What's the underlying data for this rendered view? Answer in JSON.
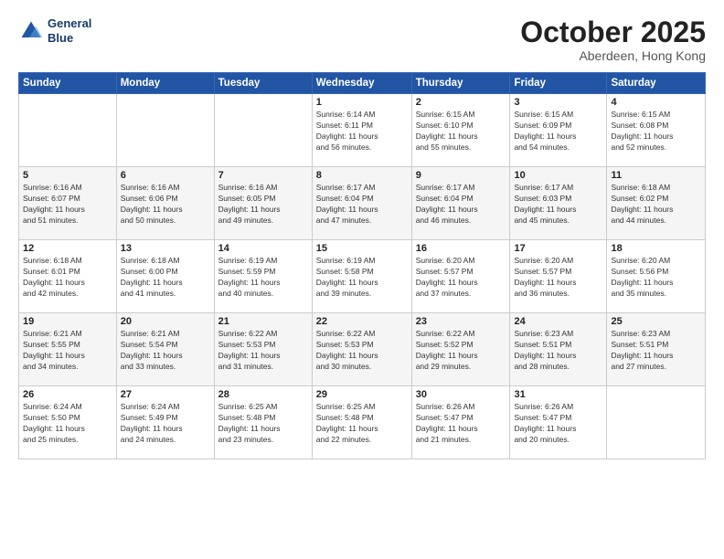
{
  "header": {
    "logo_line1": "General",
    "logo_line2": "Blue",
    "month": "October 2025",
    "location": "Aberdeen, Hong Kong"
  },
  "weekdays": [
    "Sunday",
    "Monday",
    "Tuesday",
    "Wednesday",
    "Thursday",
    "Friday",
    "Saturday"
  ],
  "weeks": [
    [
      {
        "day": "",
        "info": ""
      },
      {
        "day": "",
        "info": ""
      },
      {
        "day": "",
        "info": ""
      },
      {
        "day": "1",
        "info": "Sunrise: 6:14 AM\nSunset: 6:11 PM\nDaylight: 11 hours\nand 56 minutes."
      },
      {
        "day": "2",
        "info": "Sunrise: 6:15 AM\nSunset: 6:10 PM\nDaylight: 11 hours\nand 55 minutes."
      },
      {
        "day": "3",
        "info": "Sunrise: 6:15 AM\nSunset: 6:09 PM\nDaylight: 11 hours\nand 54 minutes."
      },
      {
        "day": "4",
        "info": "Sunrise: 6:15 AM\nSunset: 6:08 PM\nDaylight: 11 hours\nand 52 minutes."
      }
    ],
    [
      {
        "day": "5",
        "info": "Sunrise: 6:16 AM\nSunset: 6:07 PM\nDaylight: 11 hours\nand 51 minutes."
      },
      {
        "day": "6",
        "info": "Sunrise: 6:16 AM\nSunset: 6:06 PM\nDaylight: 11 hours\nand 50 minutes."
      },
      {
        "day": "7",
        "info": "Sunrise: 6:16 AM\nSunset: 6:05 PM\nDaylight: 11 hours\nand 49 minutes."
      },
      {
        "day": "8",
        "info": "Sunrise: 6:17 AM\nSunset: 6:04 PM\nDaylight: 11 hours\nand 47 minutes."
      },
      {
        "day": "9",
        "info": "Sunrise: 6:17 AM\nSunset: 6:04 PM\nDaylight: 11 hours\nand 46 minutes."
      },
      {
        "day": "10",
        "info": "Sunrise: 6:17 AM\nSunset: 6:03 PM\nDaylight: 11 hours\nand 45 minutes."
      },
      {
        "day": "11",
        "info": "Sunrise: 6:18 AM\nSunset: 6:02 PM\nDaylight: 11 hours\nand 44 minutes."
      }
    ],
    [
      {
        "day": "12",
        "info": "Sunrise: 6:18 AM\nSunset: 6:01 PM\nDaylight: 11 hours\nand 42 minutes."
      },
      {
        "day": "13",
        "info": "Sunrise: 6:18 AM\nSunset: 6:00 PM\nDaylight: 11 hours\nand 41 minutes."
      },
      {
        "day": "14",
        "info": "Sunrise: 6:19 AM\nSunset: 5:59 PM\nDaylight: 11 hours\nand 40 minutes."
      },
      {
        "day": "15",
        "info": "Sunrise: 6:19 AM\nSunset: 5:58 PM\nDaylight: 11 hours\nand 39 minutes."
      },
      {
        "day": "16",
        "info": "Sunrise: 6:20 AM\nSunset: 5:57 PM\nDaylight: 11 hours\nand 37 minutes."
      },
      {
        "day": "17",
        "info": "Sunrise: 6:20 AM\nSunset: 5:57 PM\nDaylight: 11 hours\nand 36 minutes."
      },
      {
        "day": "18",
        "info": "Sunrise: 6:20 AM\nSunset: 5:56 PM\nDaylight: 11 hours\nand 35 minutes."
      }
    ],
    [
      {
        "day": "19",
        "info": "Sunrise: 6:21 AM\nSunset: 5:55 PM\nDaylight: 11 hours\nand 34 minutes."
      },
      {
        "day": "20",
        "info": "Sunrise: 6:21 AM\nSunset: 5:54 PM\nDaylight: 11 hours\nand 33 minutes."
      },
      {
        "day": "21",
        "info": "Sunrise: 6:22 AM\nSunset: 5:53 PM\nDaylight: 11 hours\nand 31 minutes."
      },
      {
        "day": "22",
        "info": "Sunrise: 6:22 AM\nSunset: 5:53 PM\nDaylight: 11 hours\nand 30 minutes."
      },
      {
        "day": "23",
        "info": "Sunrise: 6:22 AM\nSunset: 5:52 PM\nDaylight: 11 hours\nand 29 minutes."
      },
      {
        "day": "24",
        "info": "Sunrise: 6:23 AM\nSunset: 5:51 PM\nDaylight: 11 hours\nand 28 minutes."
      },
      {
        "day": "25",
        "info": "Sunrise: 6:23 AM\nSunset: 5:51 PM\nDaylight: 11 hours\nand 27 minutes."
      }
    ],
    [
      {
        "day": "26",
        "info": "Sunrise: 6:24 AM\nSunset: 5:50 PM\nDaylight: 11 hours\nand 25 minutes."
      },
      {
        "day": "27",
        "info": "Sunrise: 6:24 AM\nSunset: 5:49 PM\nDaylight: 11 hours\nand 24 minutes."
      },
      {
        "day": "28",
        "info": "Sunrise: 6:25 AM\nSunset: 5:48 PM\nDaylight: 11 hours\nand 23 minutes."
      },
      {
        "day": "29",
        "info": "Sunrise: 6:25 AM\nSunset: 5:48 PM\nDaylight: 11 hours\nand 22 minutes."
      },
      {
        "day": "30",
        "info": "Sunrise: 6:26 AM\nSunset: 5:47 PM\nDaylight: 11 hours\nand 21 minutes."
      },
      {
        "day": "31",
        "info": "Sunrise: 6:26 AM\nSunset: 5:47 PM\nDaylight: 11 hours\nand 20 minutes."
      },
      {
        "day": "",
        "info": ""
      }
    ]
  ]
}
